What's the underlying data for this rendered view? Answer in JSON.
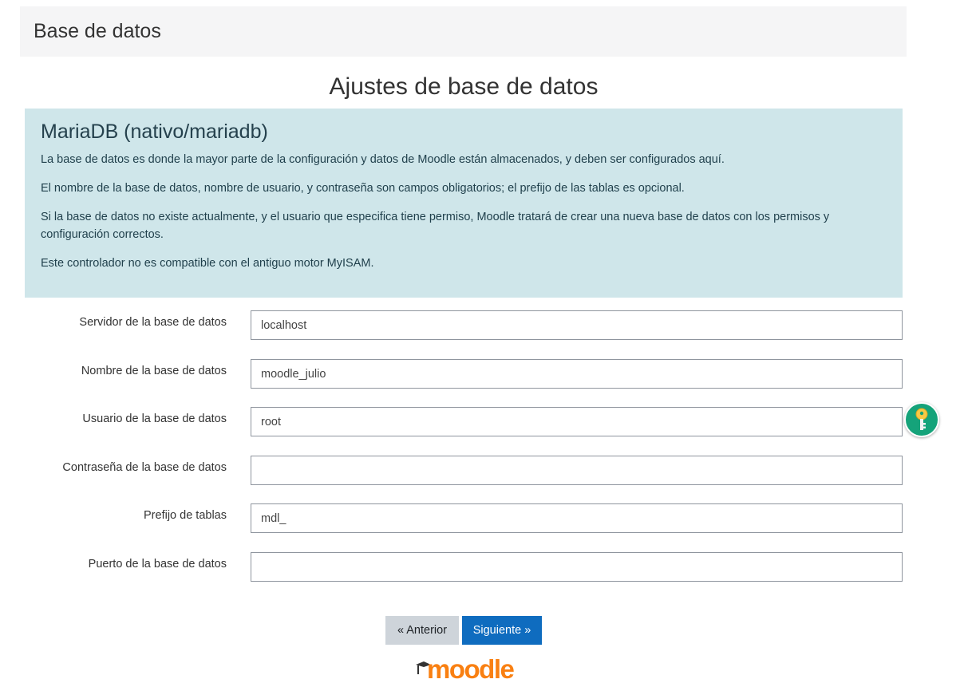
{
  "header": {
    "title": "Base de datos"
  },
  "page_title": "Ajustes de base de datos",
  "info_box": {
    "title": "MariaDB (nativo/mariadb)",
    "paragraphs": [
      "La base de datos es donde la mayor parte de la configuración y datos de Moodle están almacenados, y deben ser configurados aquí.",
      "El nombre de la base de datos, nombre de usuario, y contraseña son campos obligatorios; el prefijo de las tablas es opcional.",
      "Si la base de datos no existe actualmente, y el usuario que especifica tiene permiso, Moodle tratará de crear una nueva base de datos con los permisos y configuración correctos.",
      "Este controlador no es compatible con el antiguo motor MyISAM."
    ]
  },
  "form": {
    "fields": [
      {
        "label": "Servidor de la base de datos",
        "value": "localhost"
      },
      {
        "label": "Nombre de la base de datos",
        "value": "moodle_julio"
      },
      {
        "label": "Usuario de la base de datos",
        "value": "root"
      },
      {
        "label": "Contraseña de la base de datos",
        "value": ""
      },
      {
        "label": "Prefijo de tablas",
        "value": "mdl_"
      },
      {
        "label": "Puerto de la base de datos",
        "value": ""
      }
    ]
  },
  "buttons": {
    "previous": "« Anterior",
    "next": "Siguiente »"
  },
  "footer": {
    "logo_text": "moodle"
  },
  "icons": {
    "key": "key-icon",
    "logo_hat": "graduation-cap-icon"
  },
  "colors": {
    "accent": "#0f6cbf",
    "info_bg": "#cfe6ea",
    "brand": "#f98012",
    "key_button": "#15a37a"
  }
}
